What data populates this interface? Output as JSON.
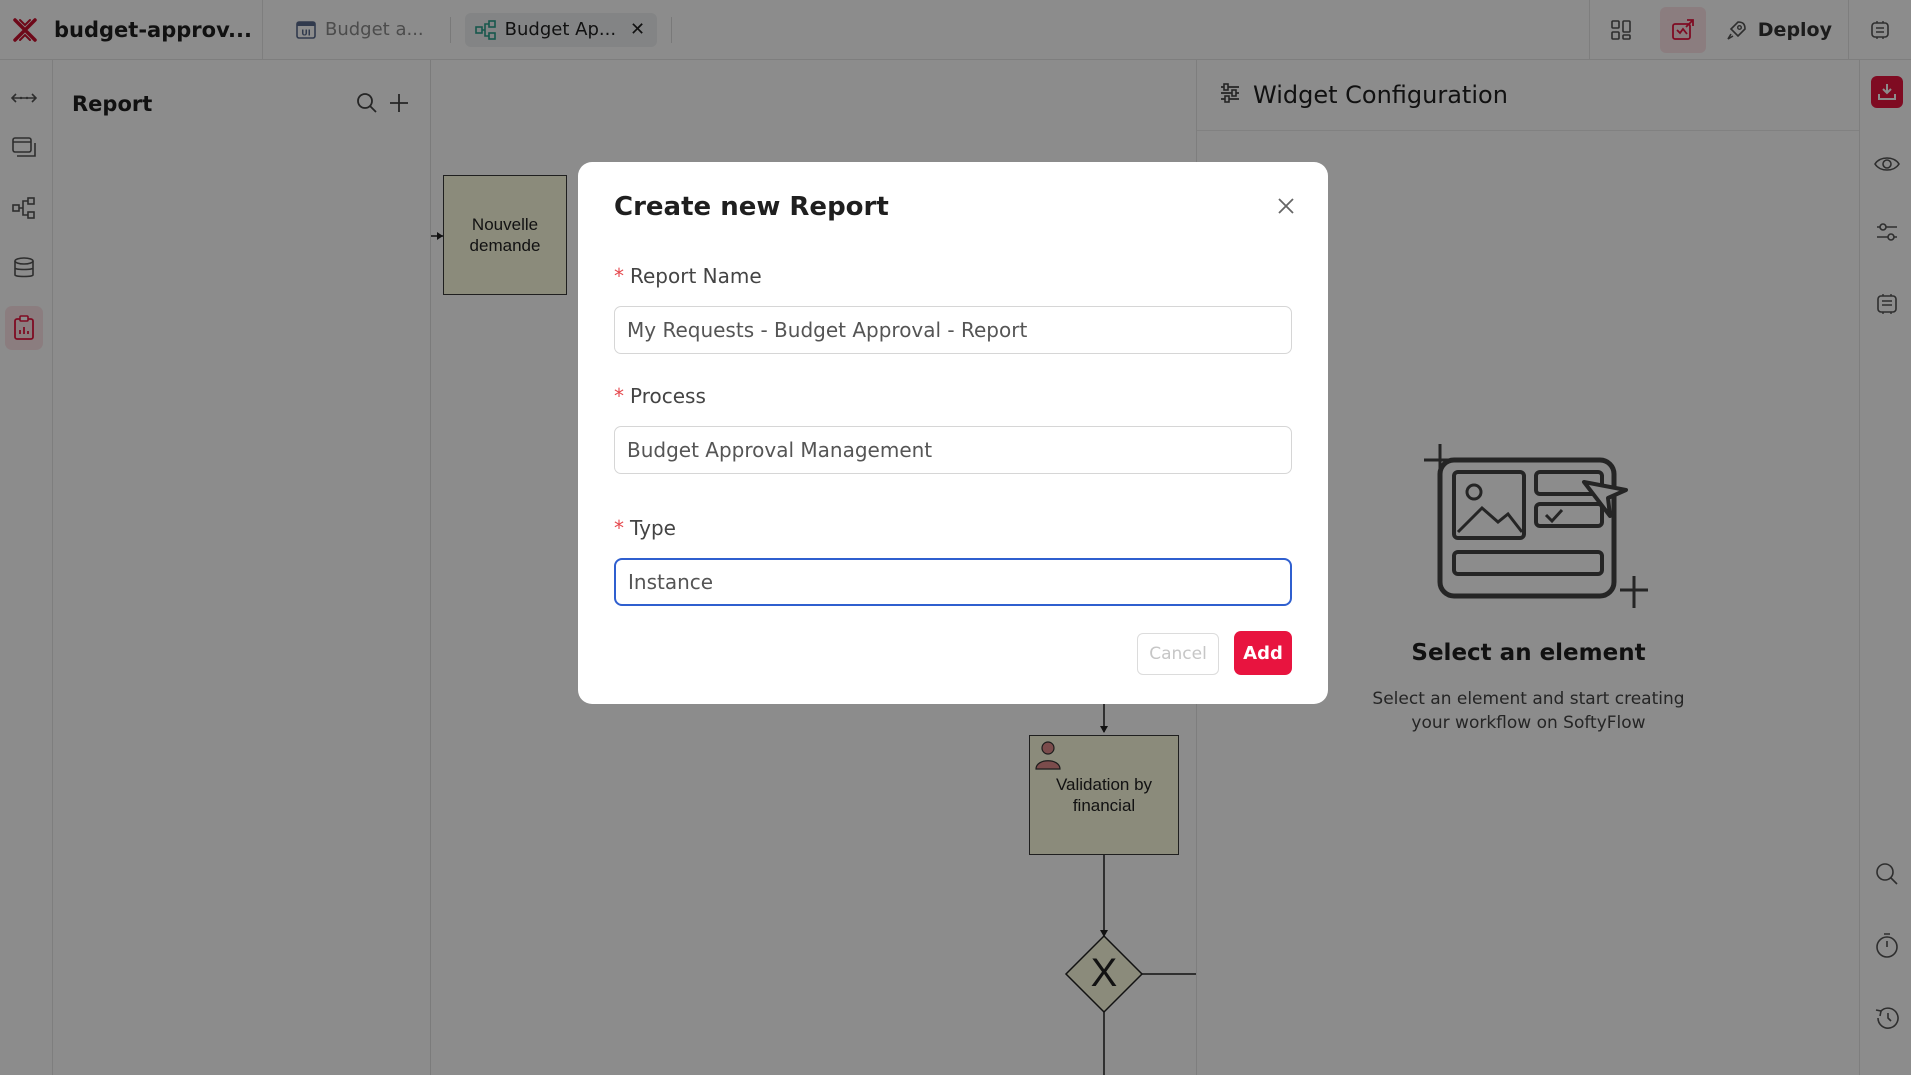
{
  "app": {
    "name": "budget-approv...",
    "brand_color": "#c8102e"
  },
  "tabs": [
    {
      "label": "Budget a...",
      "icon": "ui-page-icon",
      "active": false
    },
    {
      "label": "Budget Ap...",
      "icon": "process-flow-icon",
      "active": true
    }
  ],
  "toolbar": {
    "deploy_label": "Deploy"
  },
  "sidebar": {
    "title": "Report",
    "rail": [
      "api-icon",
      "pages-icon",
      "process-icon",
      "database-icon",
      "report-icon"
    ]
  },
  "canvas": {
    "tasks": [
      {
        "label": "Nouvelle demande"
      },
      {
        "label": "Validation by financial"
      }
    ],
    "gateway_symbol": "X"
  },
  "config": {
    "title": "Widget Configuration",
    "empty_title": "Select an element",
    "empty_desc": "Select an element and start creating your workflow on SoftyFlow"
  },
  "modal": {
    "title": "Create new Report",
    "fields": {
      "report_name": {
        "label": "Report Name",
        "value": "My Requests - Budget Approval - Report",
        "required": true
      },
      "process": {
        "label": "Process",
        "value": "Budget Approval Management",
        "required": true
      },
      "type": {
        "label": "Type",
        "value": "Instance",
        "required": true
      }
    },
    "required_mark": "*",
    "cancel_label": "Cancel",
    "add_label": "Add"
  },
  "colors": {
    "accent": "#e8143f",
    "focus": "#2f5fcf",
    "task_fill": "#fdfde0"
  }
}
